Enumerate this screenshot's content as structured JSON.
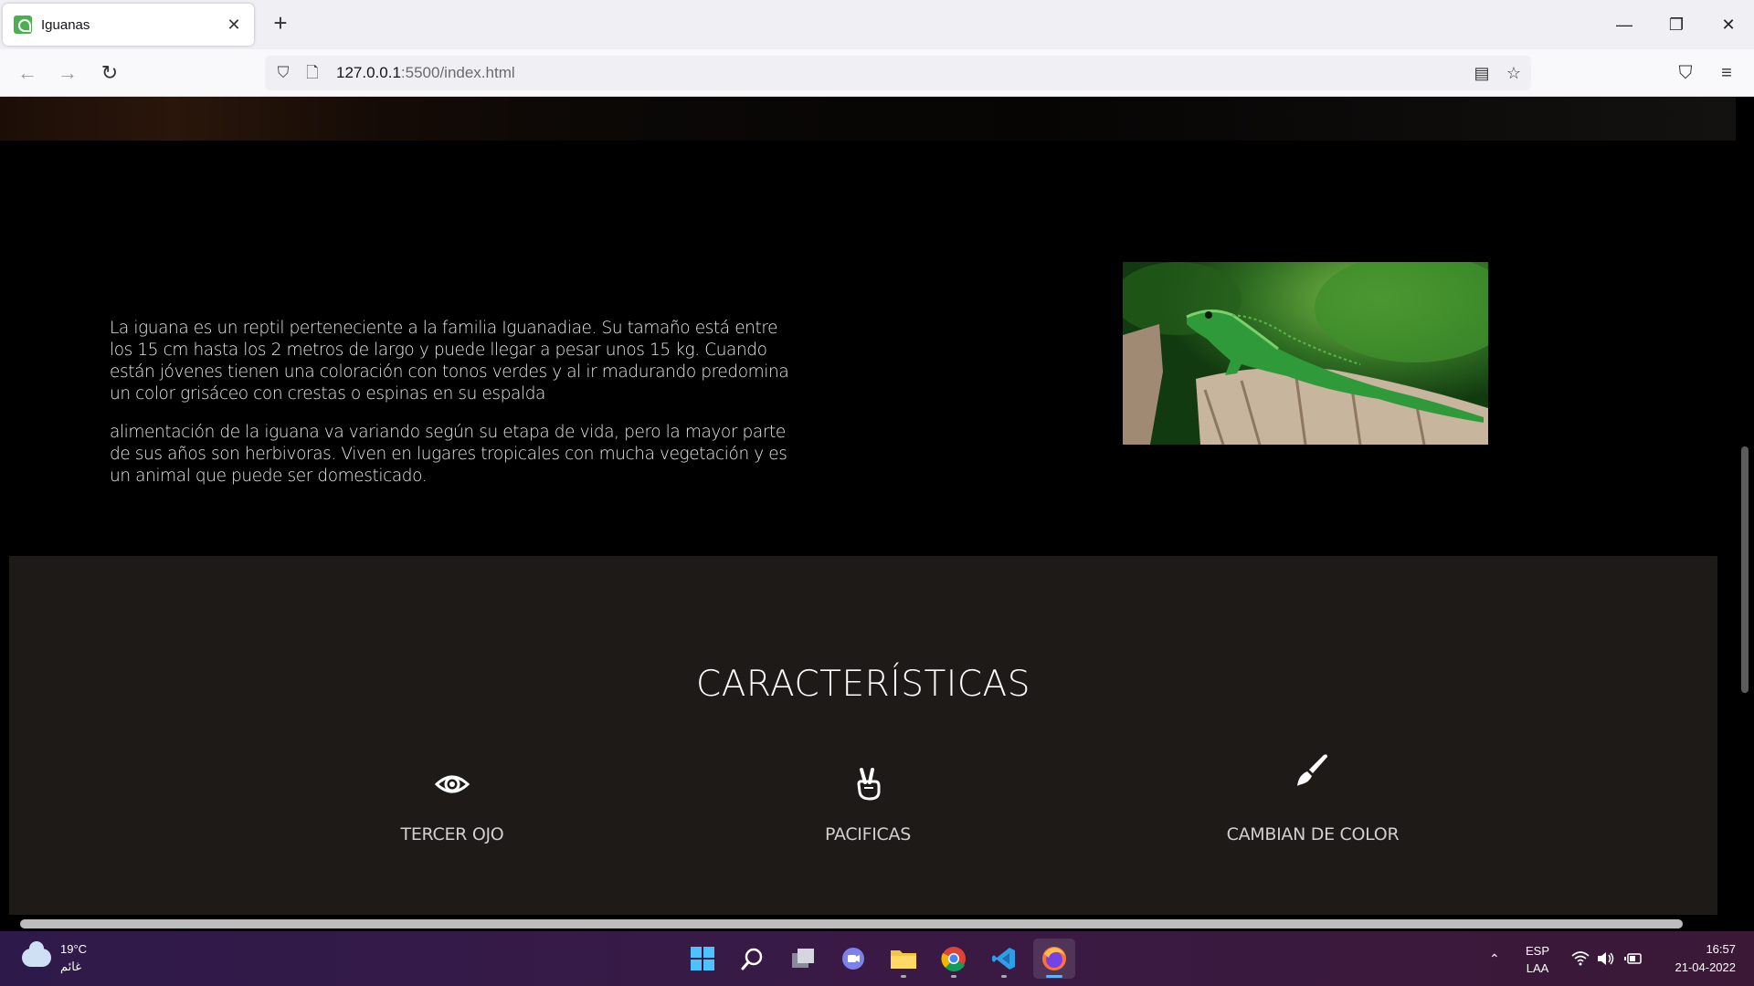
{
  "browser": {
    "tab_title": "Iguanas",
    "url_host": "127.0.0.1",
    "url_path": ":5500/index.html"
  },
  "page": {
    "intro_paragraph_1": "La iguana es un reptil perteneciente a la familia Iguanadiae. Su tamaño está entre los 15 cm hasta los 2 metros de largo y puede llegar a pesar unos 15 kg. Cuando están jóvenes tienen una coloración con tonos verdes y al ir madurando predomina un color grisáceo con crestas o espinas en su espalda",
    "intro_paragraph_2": "alimentación de la iguana va variando según su etapa de vida, pero la mayor parte de sus años son herbivoras. Viven en lugares tropicales con mucha vegetación y es un animal que puede ser domesticado.",
    "features_title": "CARACTERÍSTICAS",
    "features": [
      {
        "label": "TERCER OJO",
        "icon": "eye-icon"
      },
      {
        "label": "PACIFICAS",
        "icon": "peace-hand-icon"
      },
      {
        "label": "CAMBIAN DE COLOR",
        "icon": "paintbrush-icon"
      }
    ]
  },
  "taskbar": {
    "temperature": "19°C",
    "weather_desc": "غائم",
    "lang_top": "ESP",
    "lang_bottom": "LAA",
    "time": "16:57",
    "date": "21-04-2022"
  },
  "colors": {
    "page_bg": "#000000",
    "features_bg": "#1d1a17",
    "text": "#e7e7e7"
  }
}
